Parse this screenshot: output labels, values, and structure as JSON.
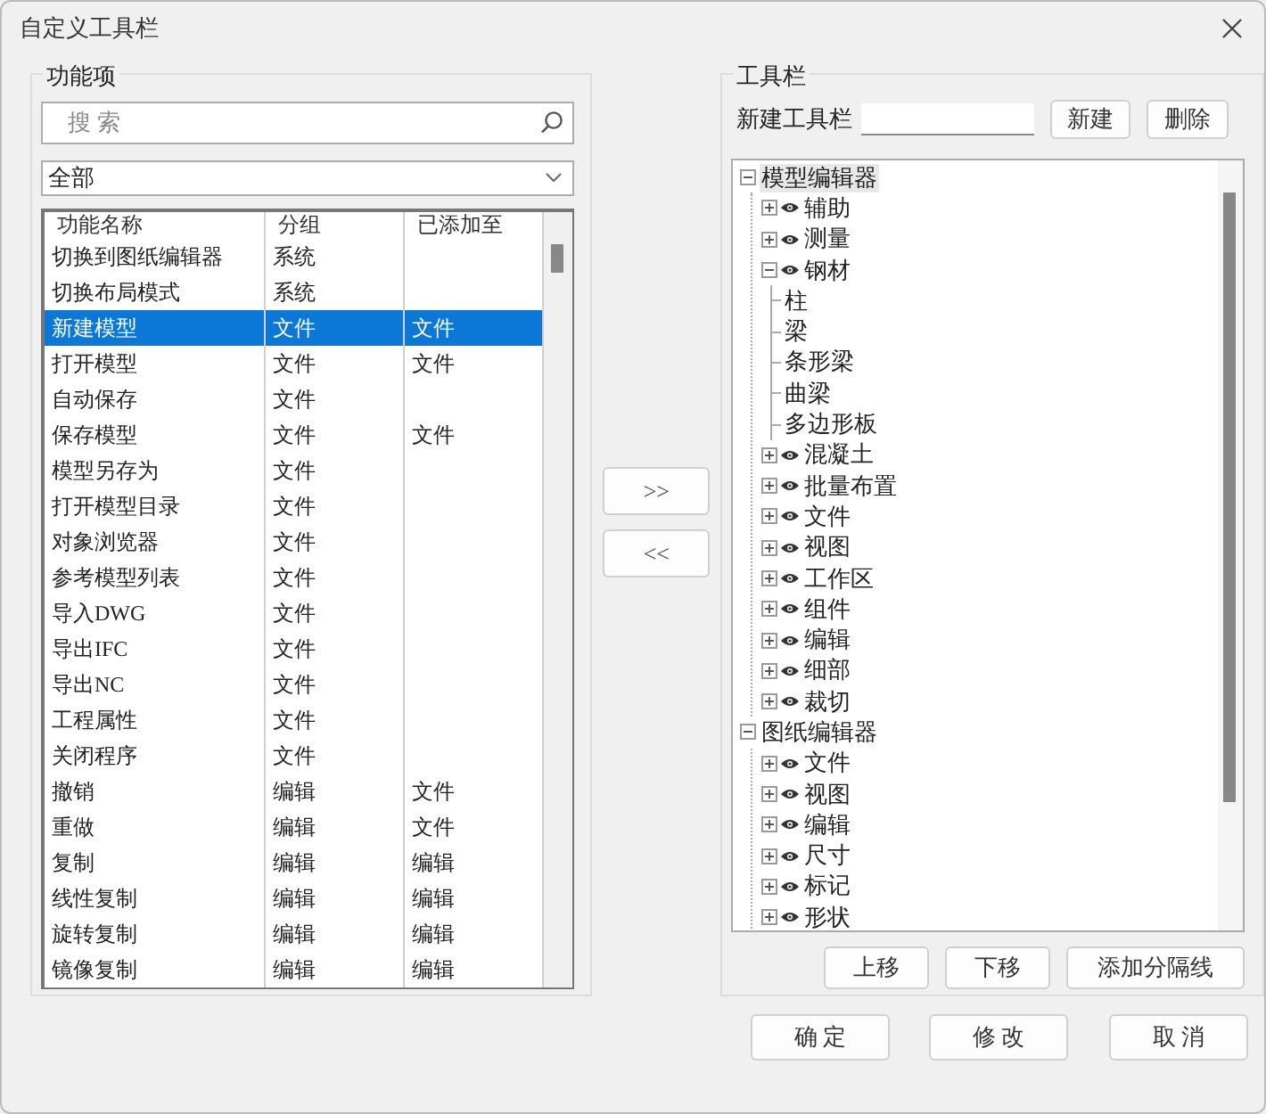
{
  "window": {
    "title": "自定义工具栏"
  },
  "functions": {
    "title": "功能项",
    "search": {
      "placeholder": "搜 索"
    },
    "filter": {
      "value": "全部"
    },
    "columns": [
      "功能名称",
      "分组",
      "已添加至"
    ],
    "rows": [
      {
        "name": "切换到图纸编辑器",
        "group": "系统",
        "selected": false
      },
      {
        "name": "切换布局模式",
        "group": "系统",
        "selected": false
      },
      {
        "name": "新建模型",
        "group": "文件",
        "added": "文件",
        "selected": true
      },
      {
        "name": "打开模型",
        "group": "文件",
        "added": "文件",
        "selected": false
      },
      {
        "name": "自动保存",
        "group": "文件",
        "selected": false
      },
      {
        "name": "保存模型",
        "group": "文件",
        "added": "文件",
        "selected": false
      },
      {
        "name": "模型另存为",
        "group": "文件",
        "selected": false
      },
      {
        "name": "打开模型目录",
        "group": "文件",
        "selected": false
      },
      {
        "name": "对象浏览器",
        "group": "文件",
        "selected": false
      },
      {
        "name": "参考模型列表",
        "group": "文件",
        "selected": false
      },
      {
        "name": "导入DWG",
        "group": "文件",
        "selected": false
      },
      {
        "name": "导出IFC",
        "group": "文件",
        "selected": false
      },
      {
        "name": "导出NC",
        "group": "文件",
        "selected": false
      },
      {
        "name": "工程属性",
        "group": "文件",
        "selected": false
      },
      {
        "name": "关闭程序",
        "group": "文件",
        "selected": false
      },
      {
        "name": "撤销",
        "group": "编辑",
        "added": "文件",
        "selected": false
      },
      {
        "name": "重做",
        "group": "编辑",
        "added": "文件",
        "selected": false
      },
      {
        "name": "复制",
        "group": "编辑",
        "added": "编辑",
        "selected": false
      },
      {
        "name": "线性复制",
        "group": "编辑",
        "added": "编辑",
        "selected": false
      },
      {
        "name": "旋转复制",
        "group": "编辑",
        "added": "编辑",
        "selected": false
      },
      {
        "name": "镜像复制",
        "group": "编辑",
        "added": "编辑",
        "selected": false
      }
    ]
  },
  "transfer_buttons": [
    ">>",
    "<<"
  ],
  "toolbars": {
    "title": "工具栏",
    "new_label": "新建工具栏",
    "buttons": [
      "新建",
      "删除"
    ],
    "tree": [
      {
        "label": "模型编辑器",
        "kind": "editor",
        "expanded": true,
        "selected": true,
        "children": [
          {
            "label": "辅助",
            "kind": "toolbar",
            "expanded": false,
            "selected": false
          },
          {
            "label": "测量",
            "kind": "toolbar",
            "expanded": false,
            "selected": false
          },
          {
            "label": "钢材",
            "kind": "toolbar",
            "expanded": true,
            "selected": false,
            "children": [
              {
                "label": "柱",
                "kind": "command",
                "selected": false
              },
              {
                "label": "梁",
                "kind": "command",
                "selected": false
              },
              {
                "label": "条形梁",
                "kind": "command",
                "selected": false
              },
              {
                "label": "曲梁",
                "kind": "command",
                "selected": false
              },
              {
                "label": "多边形板",
                "kind": "command",
                "selected": false
              }
            ]
          },
          {
            "label": "混凝土",
            "kind": "toolbar",
            "expanded": false,
            "selected": false
          },
          {
            "label": "批量布置",
            "kind": "toolbar",
            "expanded": false,
            "selected": false
          },
          {
            "label": "文件",
            "kind": "toolbar",
            "expanded": false,
            "selected": false
          },
          {
            "label": "视图",
            "kind": "toolbar",
            "expanded": false,
            "selected": false
          },
          {
            "label": "工作区",
            "kind": "toolbar",
            "expanded": false,
            "selected": false
          },
          {
            "label": "组件",
            "kind": "toolbar",
            "expanded": false,
            "selected": false
          },
          {
            "label": "编辑",
            "kind": "toolbar",
            "expanded": false,
            "selected": false
          },
          {
            "label": "细部",
            "kind": "toolbar",
            "expanded": false,
            "selected": false
          },
          {
            "label": "裁切",
            "kind": "toolbar",
            "expanded": false,
            "selected": false
          }
        ]
      },
      {
        "label": "图纸编辑器",
        "kind": "editor",
        "expanded": true,
        "selected": false,
        "children": [
          {
            "label": "文件",
            "kind": "toolbar",
            "expanded": false,
            "selected": false
          },
          {
            "label": "视图",
            "kind": "toolbar",
            "expanded": false,
            "selected": false
          },
          {
            "label": "编辑",
            "kind": "toolbar",
            "expanded": false,
            "selected": false
          },
          {
            "label": "尺寸",
            "kind": "toolbar",
            "expanded": false,
            "selected": false
          },
          {
            "label": "标记",
            "kind": "toolbar",
            "expanded": false,
            "selected": false
          },
          {
            "label": "形状",
            "kind": "toolbar",
            "expanded": false,
            "selected": false
          }
        ]
      }
    ],
    "order_buttons": [
      "上移",
      "下移",
      "添加分隔线"
    ]
  },
  "footer_buttons": [
    "确 定",
    "修 改",
    "取 消"
  ]
}
